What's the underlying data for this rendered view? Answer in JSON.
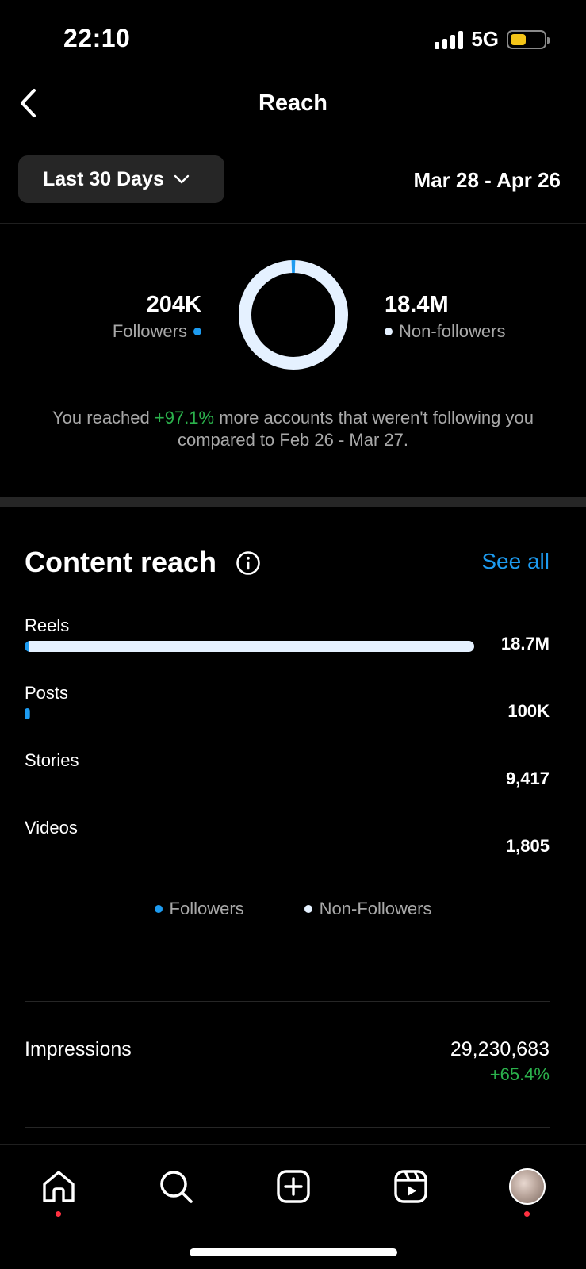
{
  "status_bar": {
    "time": "22:10",
    "network": "5G"
  },
  "header": {
    "title": "Reach"
  },
  "range": {
    "label": "Last 30 Days",
    "dates": "Mar 28 - Apr 26"
  },
  "audience": {
    "followers_value": "204K",
    "followers_label": "Followers",
    "nonfollowers_value": "18.4M",
    "nonfollowers_label": "Non-followers",
    "summary_prefix": "You reached ",
    "summary_change": "+97.1%",
    "summary_suffix": " more accounts that weren't following you compared to Feb 26 - Mar 27."
  },
  "content_reach": {
    "title": "Content reach",
    "see_all": "See all",
    "rows": [
      {
        "label": "Reels",
        "value": "18.7M",
        "fill": 1.0,
        "followers_share": 0.01
      },
      {
        "label": "Posts",
        "value": "100K",
        "fill": 0.012,
        "followers_share": 0.85
      },
      {
        "label": "Stories",
        "value": "9,417",
        "fill": 0,
        "followers_share": 0
      },
      {
        "label": "Videos",
        "value": "1,805",
        "fill": 0,
        "followers_share": 0
      }
    ],
    "legend": {
      "followers": "Followers",
      "nonfollowers": "Non-Followers"
    }
  },
  "impressions": {
    "label": "Impressions",
    "value": "29,230,683",
    "change": "+65.4%"
  },
  "colors": {
    "followers": "#1d9bf0",
    "nonfollowers": "#e5f1ff",
    "positive": "#2bb24c",
    "link": "#1d9bf0"
  },
  "nav": {
    "icons": [
      "home-icon",
      "search-icon",
      "create-icon",
      "reels-icon",
      "profile-avatar"
    ]
  }
}
